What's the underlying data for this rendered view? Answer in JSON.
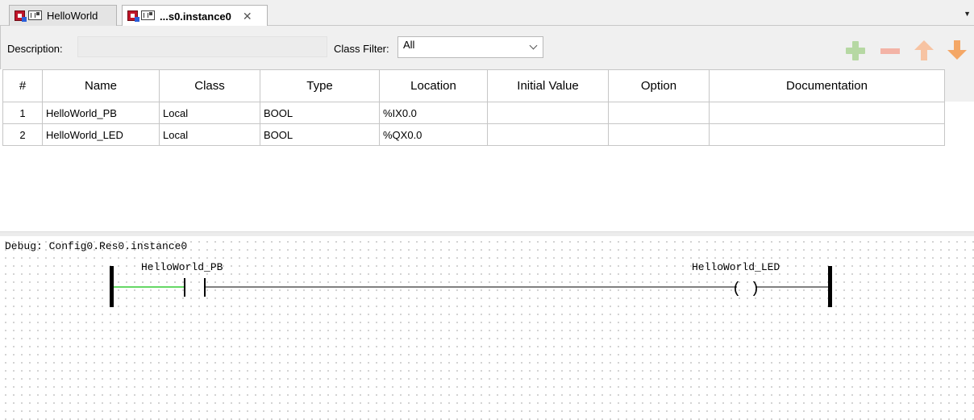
{
  "tabs": [
    {
      "label": "HelloWorld",
      "icon": "poe-program-icon"
    },
    {
      "label": "...s0.instance0",
      "icon": "poe-program-icon",
      "close": "✕",
      "active": true
    }
  ],
  "toolbar": {
    "description_label": "Description:",
    "description_value": "",
    "class_filter_label": "Class Filter:",
    "class_filter_value": "All",
    "buttons": [
      "add-variable",
      "remove-variable",
      "move-up",
      "move-down"
    ]
  },
  "table": {
    "headers": [
      "#",
      "Name",
      "Class",
      "Type",
      "Location",
      "Initial Value",
      "Option",
      "Documentation"
    ],
    "rows": [
      [
        "1",
        "HelloWorld_PB",
        "Local",
        "BOOL",
        "%IX0.0",
        "",
        "",
        ""
      ],
      [
        "2",
        "HelloWorld_LED",
        "Local",
        "BOOL",
        "%QX0.0",
        "",
        "",
        ""
      ]
    ]
  },
  "debug": {
    "label": "Debug: Config0.Res0.instance0",
    "contact_name": "HelloWorld_PB",
    "coil_name": "HelloWorld_LED",
    "coil_symbol": "( )",
    "active_color": "#33cc33"
  }
}
